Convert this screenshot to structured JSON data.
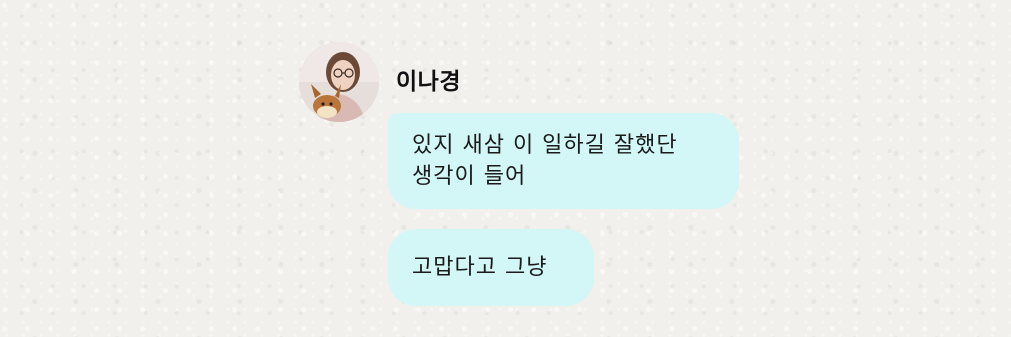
{
  "contact": {
    "name": "이나경"
  },
  "messages": [
    {
      "lines": [
        "있지 새삼 이 일하길 잘했단",
        "생각이 들어"
      ]
    },
    {
      "lines": [
        "고맙다고 그냥"
      ]
    }
  ],
  "colors": {
    "bubble": "#d3f6f6",
    "background": "#f1f0ec",
    "text": "#1a1a1a"
  }
}
